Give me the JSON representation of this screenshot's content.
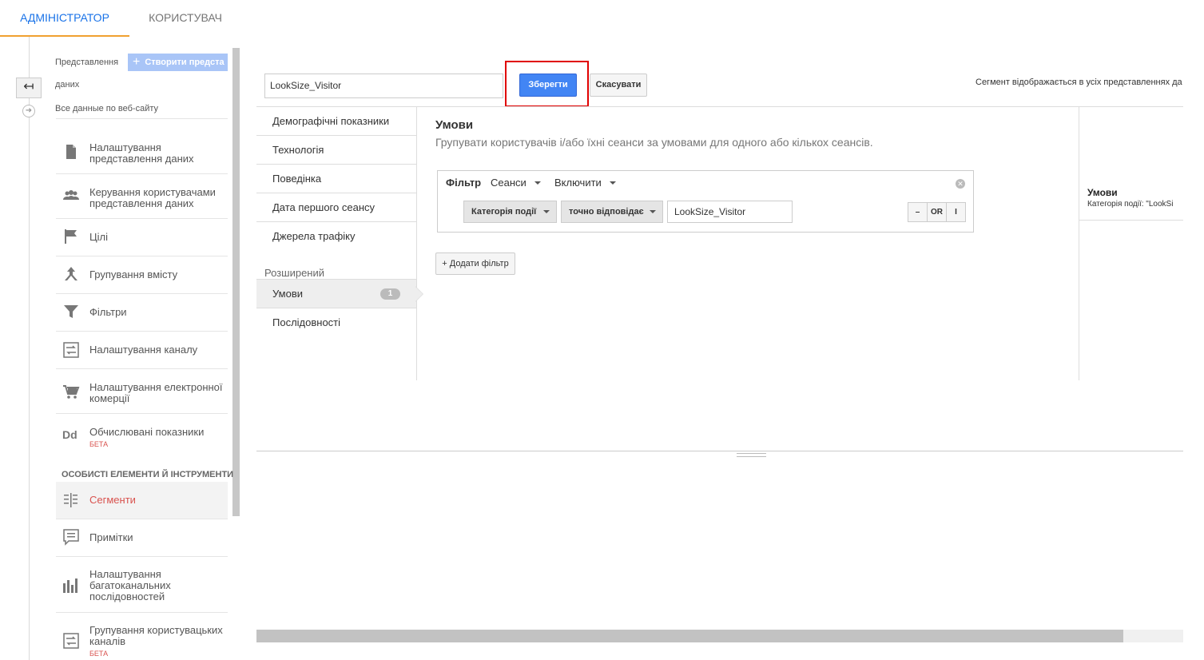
{
  "tabs": {
    "admin": "АДМІНІСТРАТОР",
    "user": "КОРИСТУВАЧ"
  },
  "nav": {
    "view_label_1": "Представлення",
    "view_label_2": "даних",
    "create_button": "Створити предста",
    "current_view": "Все данные по веб-сайту",
    "items": [
      {
        "label": "Налаштування представлення даних",
        "icon": "document-icon"
      },
      {
        "label": "Керування користувачами представлення даних",
        "icon": "people-icon"
      },
      {
        "label": "Цілі",
        "icon": "flag-icon"
      },
      {
        "label": "Групування вмісту",
        "icon": "grouping-icon"
      },
      {
        "label": "Фільтри",
        "icon": "funnel-icon"
      },
      {
        "label": "Налаштування каналу",
        "icon": "channel-icon"
      },
      {
        "label": "Налаштування електронної комерції",
        "icon": "cart-icon"
      },
      {
        "label": "Обчислювані показники",
        "icon": "dd-icon",
        "badge": "БЕТА"
      }
    ],
    "section_title": "ОСОБИСТІ ЕЛЕМЕНТИ Й ІНСТРУМЕНТИ",
    "personal_items": [
      {
        "label": "Сегменти",
        "icon": "segments-icon",
        "selected": true
      },
      {
        "label": "Примітки",
        "icon": "annotation-icon"
      },
      {
        "label": "Налаштування багатоканальних послідовностей",
        "icon": "bars-icon"
      },
      {
        "label": "Групування користувацьких каналів",
        "icon": "channel-icon",
        "badge": "БЕТА"
      }
    ]
  },
  "editor": {
    "segment_name": "LookSize_Visitor",
    "save": "Зберегти",
    "cancel": "Скасувати",
    "note": "Сегмент відображається в усіх представленнях да"
  },
  "categories": {
    "items": [
      "Демографічні показники",
      "Технологія",
      "Поведінка",
      "Дата першого сеансу",
      "Джерела трафіку"
    ],
    "advanced_label": "Розширений",
    "conditions": "Умови",
    "conditions_count": "1",
    "sequences": "Послідовності"
  },
  "conditions": {
    "title": "Умови",
    "description": "Групувати користувачів і/або їхні сеанси за умовами для одного або кількох сеансів.",
    "filter_label": "Фільтр",
    "scope": "Сеанси",
    "include": "Включити",
    "dimension": "Категорія події",
    "match_type": "точно відповідає",
    "value": "LookSize_Visitor",
    "minus": "–",
    "or": "OR",
    "and": "I",
    "add_filter": "+ Додати фільтр"
  },
  "summary": {
    "title": "Умови",
    "text": "Категорія події: \"LookSi"
  },
  "colors": {
    "accent": "#1a73e8",
    "tab_underline": "#f0a030",
    "save": "#4285f4",
    "highlight": "#e00000",
    "selected_text": "#d9534f"
  }
}
